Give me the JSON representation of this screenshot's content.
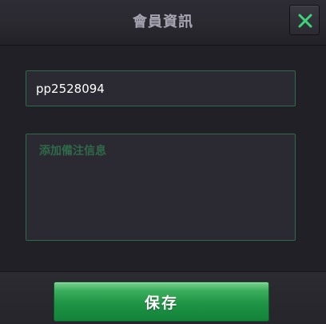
{
  "header": {
    "title": "會員資訊",
    "close_icon": "close-icon"
  },
  "form": {
    "member_id_value": "pp2528094",
    "memo_placeholder": "添加備注信息"
  },
  "footer": {
    "save_label": "保存"
  },
  "colors": {
    "accent_green": "#1f9445",
    "close_icon_green": "#3fd27a",
    "field_border": "#2f6a49",
    "title_text": "#a9a6b4"
  }
}
